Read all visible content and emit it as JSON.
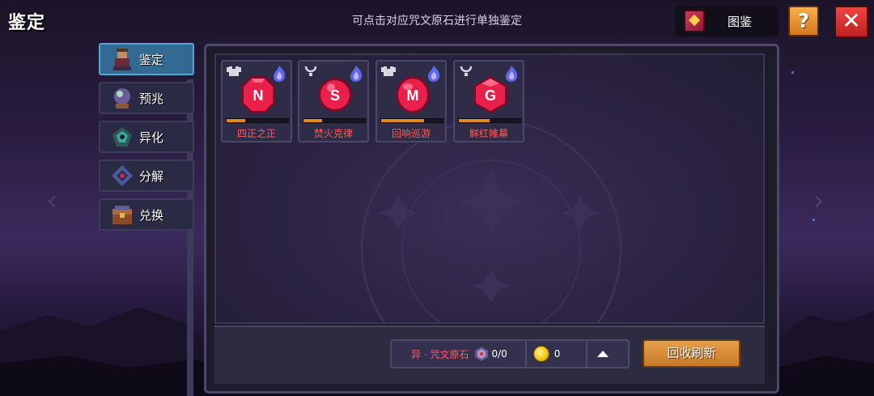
{
  "header": {
    "title": "鉴定",
    "hint": "可点击对应咒文原石进行单独鉴定",
    "codex_label": "图鉴",
    "help_label": "?",
    "close_label": "✕"
  },
  "sidebar": {
    "items": [
      {
        "label": "鉴定",
        "icon": "npc-portrait-icon",
        "active": true
      },
      {
        "label": "预兆",
        "icon": "crystal-ball-icon",
        "active": false
      },
      {
        "label": "异化",
        "icon": "mutation-emblem-icon",
        "active": false
      },
      {
        "label": "分解",
        "icon": "decompose-crystal-icon",
        "active": false
      },
      {
        "label": "兑换",
        "icon": "treasure-chest-icon",
        "active": false
      }
    ]
  },
  "cards": [
    {
      "name": "四正之正",
      "slot_icon": "armor-slot-icon",
      "rune": "N",
      "progress": 0.3
    },
    {
      "name": "焚火克律",
      "slot_icon": "necklace-slot-icon",
      "rune": "S",
      "progress": 0.3
    },
    {
      "name": "回响巡游",
      "slot_icon": "armor-slot-icon",
      "rune": "M",
      "progress": 0.7
    },
    {
      "name": "鲜红帷幕",
      "slot_icon": "necklace-slot-icon",
      "rune": "G",
      "progress": 0.5
    }
  ],
  "bottom": {
    "resource_label": "异 · 咒文原石",
    "stone_count": "0/0",
    "coin_count": "0",
    "recycle_label": "回收刷新"
  },
  "colors": {
    "accent_orange": "#e08a22",
    "card_name_red": "#ff5a5a",
    "active_tab": "#326a94"
  }
}
